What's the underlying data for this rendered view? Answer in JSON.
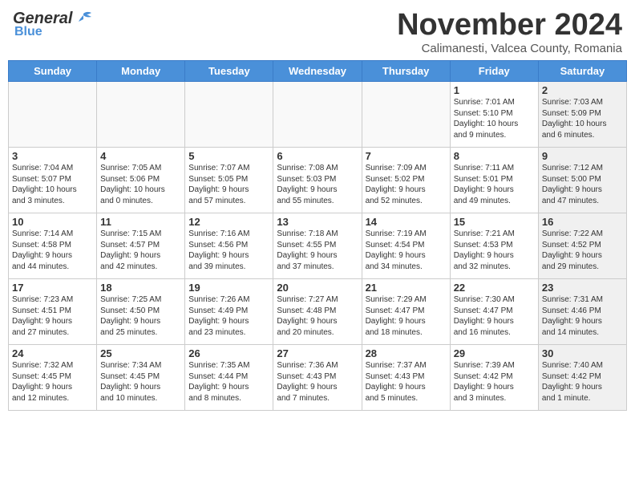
{
  "header": {
    "logo_general": "General",
    "logo_blue": "Blue",
    "month_title": "November 2024",
    "location": "Calimanesti, Valcea County, Romania"
  },
  "weekdays": [
    "Sunday",
    "Monday",
    "Tuesday",
    "Wednesday",
    "Thursday",
    "Friday",
    "Saturday"
  ],
  "weeks": [
    [
      {
        "day": "",
        "info": "",
        "empty": true
      },
      {
        "day": "",
        "info": "",
        "empty": true
      },
      {
        "day": "",
        "info": "",
        "empty": true
      },
      {
        "day": "",
        "info": "",
        "empty": true
      },
      {
        "day": "",
        "info": "",
        "empty": true
      },
      {
        "day": "1",
        "info": "Sunrise: 7:01 AM\nSunset: 5:10 PM\nDaylight: 10 hours\nand 9 minutes.",
        "empty": false,
        "shaded": false
      },
      {
        "day": "2",
        "info": "Sunrise: 7:03 AM\nSunset: 5:09 PM\nDaylight: 10 hours\nand 6 minutes.",
        "empty": false,
        "shaded": true
      }
    ],
    [
      {
        "day": "3",
        "info": "Sunrise: 7:04 AM\nSunset: 5:07 PM\nDaylight: 10 hours\nand 3 minutes.",
        "empty": false,
        "shaded": false
      },
      {
        "day": "4",
        "info": "Sunrise: 7:05 AM\nSunset: 5:06 PM\nDaylight: 10 hours\nand 0 minutes.",
        "empty": false,
        "shaded": false
      },
      {
        "day": "5",
        "info": "Sunrise: 7:07 AM\nSunset: 5:05 PM\nDaylight: 9 hours\nand 57 minutes.",
        "empty": false,
        "shaded": false
      },
      {
        "day": "6",
        "info": "Sunrise: 7:08 AM\nSunset: 5:03 PM\nDaylight: 9 hours\nand 55 minutes.",
        "empty": false,
        "shaded": false
      },
      {
        "day": "7",
        "info": "Sunrise: 7:09 AM\nSunset: 5:02 PM\nDaylight: 9 hours\nand 52 minutes.",
        "empty": false,
        "shaded": false
      },
      {
        "day": "8",
        "info": "Sunrise: 7:11 AM\nSunset: 5:01 PM\nDaylight: 9 hours\nand 49 minutes.",
        "empty": false,
        "shaded": false
      },
      {
        "day": "9",
        "info": "Sunrise: 7:12 AM\nSunset: 5:00 PM\nDaylight: 9 hours\nand 47 minutes.",
        "empty": false,
        "shaded": true
      }
    ],
    [
      {
        "day": "10",
        "info": "Sunrise: 7:14 AM\nSunset: 4:58 PM\nDaylight: 9 hours\nand 44 minutes.",
        "empty": false,
        "shaded": false
      },
      {
        "day": "11",
        "info": "Sunrise: 7:15 AM\nSunset: 4:57 PM\nDaylight: 9 hours\nand 42 minutes.",
        "empty": false,
        "shaded": false
      },
      {
        "day": "12",
        "info": "Sunrise: 7:16 AM\nSunset: 4:56 PM\nDaylight: 9 hours\nand 39 minutes.",
        "empty": false,
        "shaded": false
      },
      {
        "day": "13",
        "info": "Sunrise: 7:18 AM\nSunset: 4:55 PM\nDaylight: 9 hours\nand 37 minutes.",
        "empty": false,
        "shaded": false
      },
      {
        "day": "14",
        "info": "Sunrise: 7:19 AM\nSunset: 4:54 PM\nDaylight: 9 hours\nand 34 minutes.",
        "empty": false,
        "shaded": false
      },
      {
        "day": "15",
        "info": "Sunrise: 7:21 AM\nSunset: 4:53 PM\nDaylight: 9 hours\nand 32 minutes.",
        "empty": false,
        "shaded": false
      },
      {
        "day": "16",
        "info": "Sunrise: 7:22 AM\nSunset: 4:52 PM\nDaylight: 9 hours\nand 29 minutes.",
        "empty": false,
        "shaded": true
      }
    ],
    [
      {
        "day": "17",
        "info": "Sunrise: 7:23 AM\nSunset: 4:51 PM\nDaylight: 9 hours\nand 27 minutes.",
        "empty": false,
        "shaded": false
      },
      {
        "day": "18",
        "info": "Sunrise: 7:25 AM\nSunset: 4:50 PM\nDaylight: 9 hours\nand 25 minutes.",
        "empty": false,
        "shaded": false
      },
      {
        "day": "19",
        "info": "Sunrise: 7:26 AM\nSunset: 4:49 PM\nDaylight: 9 hours\nand 23 minutes.",
        "empty": false,
        "shaded": false
      },
      {
        "day": "20",
        "info": "Sunrise: 7:27 AM\nSunset: 4:48 PM\nDaylight: 9 hours\nand 20 minutes.",
        "empty": false,
        "shaded": false
      },
      {
        "day": "21",
        "info": "Sunrise: 7:29 AM\nSunset: 4:47 PM\nDaylight: 9 hours\nand 18 minutes.",
        "empty": false,
        "shaded": false
      },
      {
        "day": "22",
        "info": "Sunrise: 7:30 AM\nSunset: 4:47 PM\nDaylight: 9 hours\nand 16 minutes.",
        "empty": false,
        "shaded": false
      },
      {
        "day": "23",
        "info": "Sunrise: 7:31 AM\nSunset: 4:46 PM\nDaylight: 9 hours\nand 14 minutes.",
        "empty": false,
        "shaded": true
      }
    ],
    [
      {
        "day": "24",
        "info": "Sunrise: 7:32 AM\nSunset: 4:45 PM\nDaylight: 9 hours\nand 12 minutes.",
        "empty": false,
        "shaded": false
      },
      {
        "day": "25",
        "info": "Sunrise: 7:34 AM\nSunset: 4:45 PM\nDaylight: 9 hours\nand 10 minutes.",
        "empty": false,
        "shaded": false
      },
      {
        "day": "26",
        "info": "Sunrise: 7:35 AM\nSunset: 4:44 PM\nDaylight: 9 hours\nand 8 minutes.",
        "empty": false,
        "shaded": false
      },
      {
        "day": "27",
        "info": "Sunrise: 7:36 AM\nSunset: 4:43 PM\nDaylight: 9 hours\nand 7 minutes.",
        "empty": false,
        "shaded": false
      },
      {
        "day": "28",
        "info": "Sunrise: 7:37 AM\nSunset: 4:43 PM\nDaylight: 9 hours\nand 5 minutes.",
        "empty": false,
        "shaded": false
      },
      {
        "day": "29",
        "info": "Sunrise: 7:39 AM\nSunset: 4:42 PM\nDaylight: 9 hours\nand 3 minutes.",
        "empty": false,
        "shaded": false
      },
      {
        "day": "30",
        "info": "Sunrise: 7:40 AM\nSunset: 4:42 PM\nDaylight: 9 hours\nand 1 minute.",
        "empty": false,
        "shaded": true
      }
    ]
  ]
}
